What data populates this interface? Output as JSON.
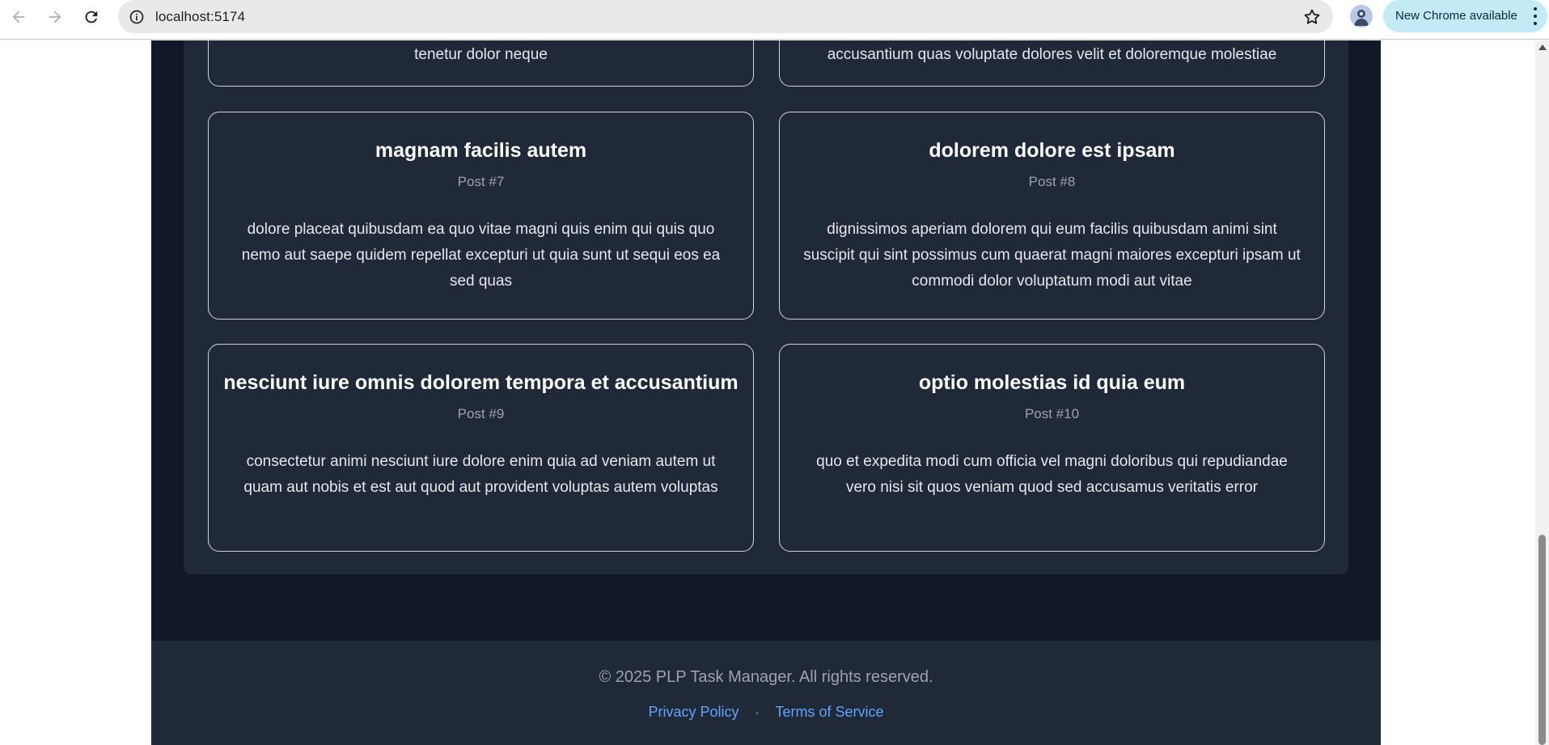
{
  "browser": {
    "url": "localhost:5174",
    "update_label": "New Chrome available"
  },
  "posts": [
    {
      "id": 5,
      "body": "tenetur dolor neque"
    },
    {
      "id": 6,
      "body": "accusantium quas voluptate dolores velit et doloremque molestiae"
    },
    {
      "id": 7,
      "title": "magnam facilis autem",
      "label": "Post #7",
      "body": "dolore placeat quibusdam ea quo vitae magni quis enim qui quis quo nemo aut saepe quidem repellat excepturi ut quia sunt ut sequi eos ea sed quas"
    },
    {
      "id": 8,
      "title": "dolorem dolore est ipsam",
      "label": "Post #8",
      "body": "dignissimos aperiam dolorem qui eum facilis quibusdam animi sint suscipit qui sint possimus cum quaerat magni maiores excepturi ipsam ut commodi dolor voluptatum modi aut vitae"
    },
    {
      "id": 9,
      "title": "nesciunt iure omnis dolorem tempora et accusantium",
      "label": "Post #9",
      "body": "consectetur animi nesciunt iure dolore enim quia ad veniam autem ut quam aut nobis et est aut quod aut provident voluptas autem voluptas"
    },
    {
      "id": 10,
      "title": "optio molestias id quia eum",
      "label": "Post #10",
      "body": "quo et expedita modi cum officia vel magni doloribus qui repudiandae vero nisi sit quos veniam quod sed accusamus veritatis error"
    }
  ],
  "footer": {
    "copyright": "© 2025 PLP Task Manager. All rights reserved.",
    "privacy_label": "Privacy Policy",
    "separator": "•",
    "terms_label": "Terms of Service"
  },
  "colors": {
    "page_bg": "#111827",
    "card_bg": "#1f2937",
    "card_border": "#d1d5db",
    "link": "#60a5fa",
    "muted_text": "#9ca3af"
  }
}
